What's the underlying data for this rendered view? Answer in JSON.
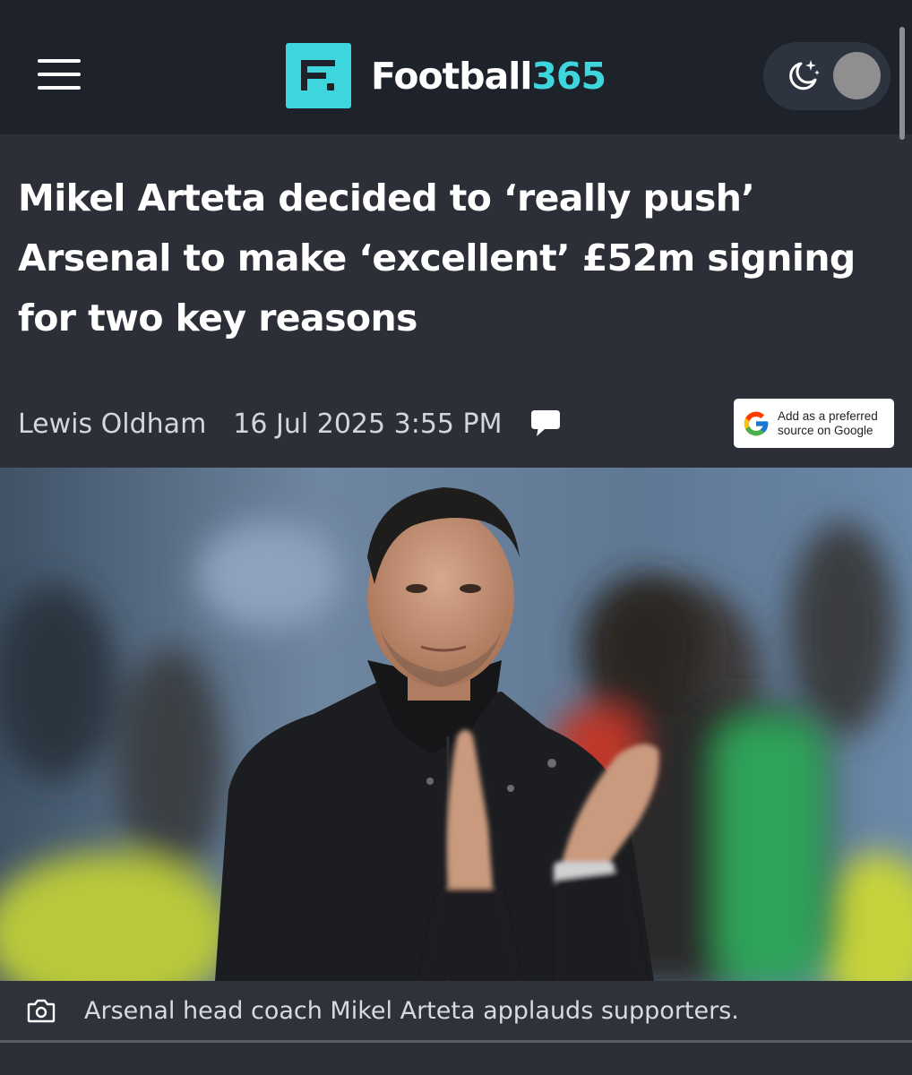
{
  "site": {
    "logo_prefix": "Football",
    "logo_suffix": "365",
    "brand_color": "#3fd5dd"
  },
  "header": {
    "menu_icon": "hamburger-menu-icon",
    "theme_toggle_icon": "moon-stars-icon"
  },
  "article": {
    "headline": "Mikel Arteta decided to ‘really push’ Arsenal to make ‘excellent’ £52m signing for two key reasons",
    "author": "Lewis Oldham",
    "date": "16 Jul 2025 3:55 PM",
    "comment_icon": "speech-bubble-icon"
  },
  "google_button": {
    "line1": "Add as a preferred",
    "line2": "source on Google",
    "icon": "google-g-icon"
  },
  "hero_image": {
    "caption_icon": "camera-icon",
    "caption": "Arsenal head coach Mikel Arteta applauds supporters."
  }
}
